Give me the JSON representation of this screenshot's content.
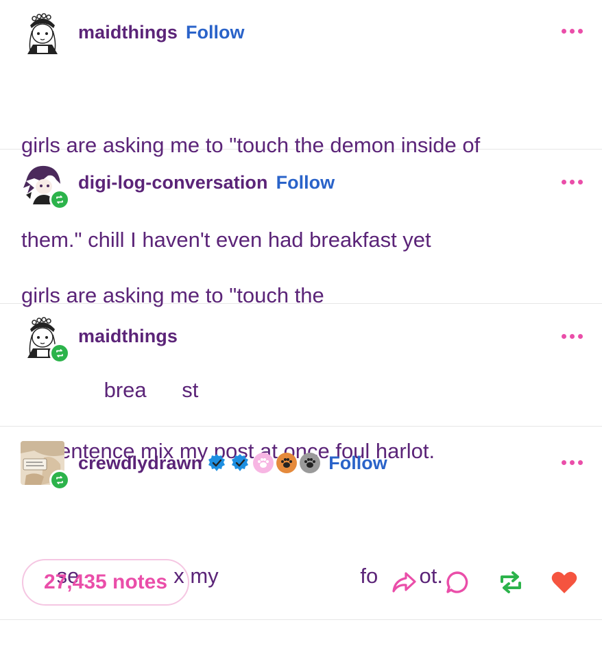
{
  "posts": [
    {
      "username": "maidthings",
      "follow_label": "Follow",
      "avatar_icon": "maid-avatar-icon",
      "reblog": false,
      "lines": [
        "girls are asking me to \"touch the demon inside of",
        "them.\" chill I haven't even had breakfast yet"
      ]
    },
    {
      "username": "digi-log-conversation",
      "follow_label": "Follow",
      "avatar_icon": "anime-avatar-icon",
      "reblog": true,
      "lines": [
        "girls are asking me to \"touch the",
        "              brea      st"
      ]
    },
    {
      "username": "maidthings",
      "follow_label": "",
      "avatar_icon": "maid-avatar-icon",
      "reblog": true,
      "lines": [
        "Unsentence mix my post at once foul harlot."
      ]
    },
    {
      "username": "crewdlydrawn",
      "follow_label": "Follow",
      "avatar_icon": "painting-avatar-icon",
      "reblog": true,
      "badges": [
        "verified-check-badge",
        "verified-star-badge",
        "pink-paw-badge",
        "orange-paw-badge",
        "black-paw-badge"
      ],
      "lines": [
        "      se                x my                        fo       ot."
      ]
    }
  ],
  "footer": {
    "notes_label": "27,435 notes",
    "actions": [
      "share-icon",
      "reply-icon",
      "reblog-icon",
      "like-icon"
    ]
  },
  "colors": {
    "username": "#5b2478",
    "follow": "#2a63c9",
    "accent_pink": "#ea4ea9",
    "reblog_green": "#2cb34b",
    "like_red": "#f5543f"
  }
}
